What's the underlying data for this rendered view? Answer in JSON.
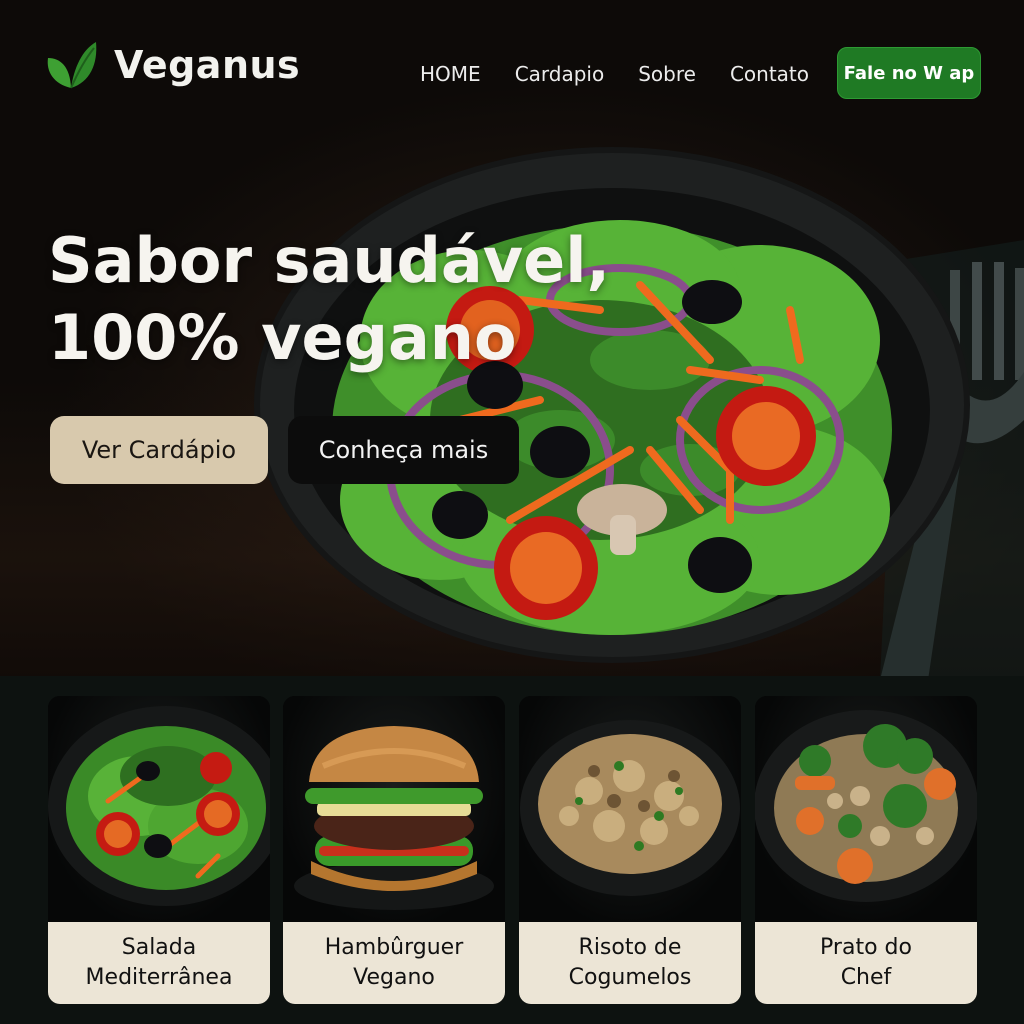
{
  "brand": {
    "name": "Veganus",
    "logo_icon": "leaf-icon",
    "accent_color": "#1f7a24"
  },
  "nav": {
    "items": [
      {
        "label": "HOME"
      },
      {
        "label": "Cardapio"
      },
      {
        "label": "Sobre"
      },
      {
        "label": "Contato"
      }
    ],
    "cta_label": "Fale no W ap"
  },
  "hero": {
    "title_line1": "Sabor saudável,",
    "title_line2": "100% vegano",
    "primary_button": "Ver Cardápio",
    "secondary_button": "Conheça mais",
    "image_icon": "salad-bowl-photo"
  },
  "menu": {
    "cards": [
      {
        "line1": "Salada",
        "line2": "Mediterrânea",
        "photo": "salad-photo"
      },
      {
        "line1": "Hambûrguer",
        "line2": "Vegano",
        "photo": "burger-photo"
      },
      {
        "line1": "Risoto de",
        "line2": "Cogumelos",
        "photo": "risotto-photo"
      },
      {
        "line1": "Prato do",
        "line2": "Chef",
        "photo": "chef-plate-photo"
      }
    ],
    "caption_bg": "#ece5d6"
  }
}
